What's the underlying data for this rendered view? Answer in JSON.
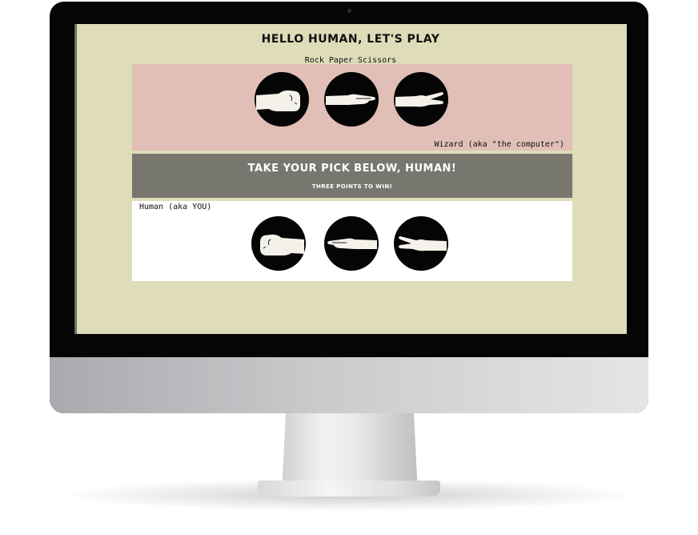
{
  "game": {
    "title": "Hello Human, Let's play",
    "subtitle": "Rock Paper Scissors"
  },
  "wizard": {
    "label": "Wizard (aka \"the computer\")",
    "choices": [
      {
        "name": "rock",
        "icon": "fist-hand-icon"
      },
      {
        "name": "paper",
        "icon": "flat-hand-icon"
      },
      {
        "name": "scissors",
        "icon": "scissors-hand-icon"
      }
    ]
  },
  "banner": {
    "heading": "Take your pick below, human!",
    "subheading": "Three points to win!"
  },
  "human": {
    "label": "Human (aka YOU)",
    "choices": [
      {
        "name": "rock",
        "icon": "fist-hand-icon"
      },
      {
        "name": "paper",
        "icon": "flat-hand-icon"
      },
      {
        "name": "scissors",
        "icon": "scissors-hand-icon"
      }
    ]
  },
  "colors": {
    "screen_background": "#dedcb9",
    "wizard_panel": "#e1bfb7",
    "banner_panel": "#777770",
    "human_panel": "#ffffff",
    "choice_circle": "#050505"
  }
}
